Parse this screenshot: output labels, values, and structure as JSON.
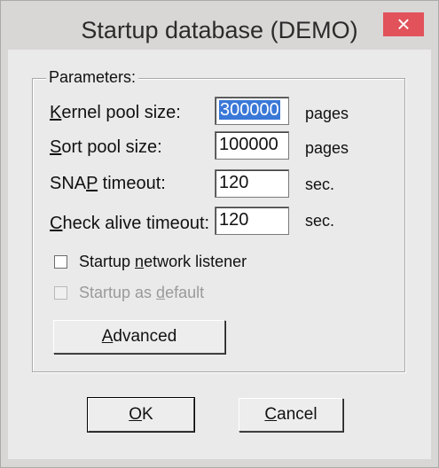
{
  "window": {
    "title": "Startup database (DEMO)",
    "close_glyph": "×",
    "close_color": "#e1525b"
  },
  "parameters": {
    "legend": "Parameters:",
    "kernel_pool": {
      "label_u": "K",
      "label_rest": "ernel pool size:",
      "value": "300000",
      "unit": "pages"
    },
    "sort_pool": {
      "label_u": "S",
      "label_rest": "ort pool size:",
      "value": "100000",
      "unit": "pages"
    },
    "snap_timeout": {
      "label_pre": "SNA",
      "label_u": "P",
      "label_rest": " timeout:",
      "value": "120",
      "unit": "sec."
    },
    "check_alive": {
      "label_u": "C",
      "label_rest": "heck alive timeout:",
      "value": "120",
      "unit": "sec."
    },
    "network_listener": {
      "label_pre": "Startup ",
      "label_u": "n",
      "label_rest": "etwork listener",
      "checked": false
    },
    "startup_default": {
      "label_pre": "Startup as ",
      "label_u": "d",
      "label_rest": "efault",
      "checked": false,
      "enabled": false
    },
    "advanced": {
      "label_u": "A",
      "label_rest": "dvanced"
    }
  },
  "buttons": {
    "ok": {
      "label_u": "O",
      "label_rest": "K"
    },
    "cancel": {
      "label_u": "C",
      "label_rest": "ancel"
    }
  }
}
